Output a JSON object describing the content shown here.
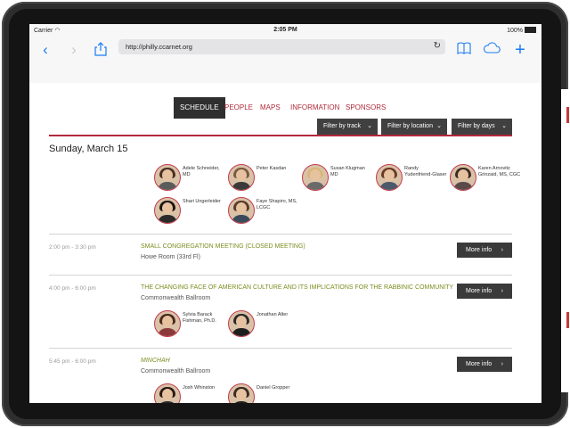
{
  "status": {
    "carrier": "Carrier",
    "time": "2:05 PM",
    "battery": "100%"
  },
  "browser": {
    "url": "http://philly.ccarnet.org"
  },
  "tabs": [
    "SCHEDULE",
    "PEOPLE",
    "MAPS",
    "INFORMATION",
    "SPONSORS"
  ],
  "filters": [
    "Filter by track",
    "Filter by location",
    "Filter by days"
  ],
  "day": "Sunday, March 15",
  "people_top": [
    "Adele Schneider, MD",
    "Peter Kasdan",
    "Susan Klugman MD",
    "Randy Yudenfriend-Glaser",
    "Karen Arnovitz Grinzaid, MS, CGC",
    "Shari Ungerleider",
    "Faye Shapiro, MS, LCGC"
  ],
  "sessions": [
    {
      "time": "2:00 pm - 3:30 pm",
      "title": "SMALL CONGREGATION MEETING (CLOSED MEETING)",
      "location": "Howe Room (33rd Fl)",
      "more": "More info",
      "speakers": []
    },
    {
      "time": "4:00 pm - 6:00 pm",
      "title": "THE CHANGING FACE OF AMERICAN CULTURE AND ITS IMPLICATIONS FOR THE RABBINIC COMMUNITY",
      "location": "Commonwealth Ballroom",
      "more": "More info",
      "speakers": [
        "Sylvia Barack Fishman, Ph.D.",
        "Jonathan Alter"
      ]
    },
    {
      "time": "5:45 pm - 6:00 pm",
      "title": "MINCHAH",
      "location": "Commonwealth Ballroom",
      "more": "More info",
      "speakers": [
        "Josh Whinston",
        "Daniel Gropper"
      ]
    }
  ],
  "colors": {
    "accent": "#b02a3a",
    "session_title": "#7b8c1e",
    "dark_button": "#3a3a3a"
  }
}
